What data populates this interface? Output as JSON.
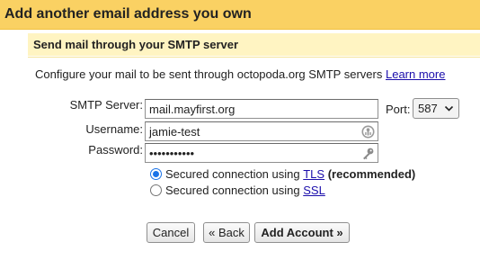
{
  "dialog": {
    "title": "Add another email address you own",
    "section_title": "Send mail through your SMTP server",
    "intro_text": "Configure your mail to be sent through octopoda.org SMTP servers",
    "learn_more": "Learn more"
  },
  "form": {
    "smtp_label": "SMTP Server:",
    "smtp_value": "mail.mayfirst.org",
    "port_label": "Port:",
    "port_value": "587",
    "username_label": "Username:",
    "username_value": "jamie-test",
    "password_label": "Password:",
    "password_value": "•••••••••••"
  },
  "security": {
    "tls_prefix": "Secured connection using",
    "tls_link": "TLS",
    "tls_suffix": "(recommended)",
    "tls_selected": true,
    "ssl_prefix": "Secured connection using",
    "ssl_link": "SSL",
    "ssl_selected": false
  },
  "buttons": {
    "cancel": "Cancel",
    "back": "« Back",
    "add_account": "Add Account »"
  },
  "colors": {
    "title_bar": "#fad163",
    "section_bar": "#fff4c2",
    "link": "#1a0dab",
    "radio_accent": "#1a73e8"
  },
  "icons": {
    "username_field": "password-manager-key-icon",
    "password_field": "key-icon",
    "port_select": "chevron-down-icon"
  }
}
